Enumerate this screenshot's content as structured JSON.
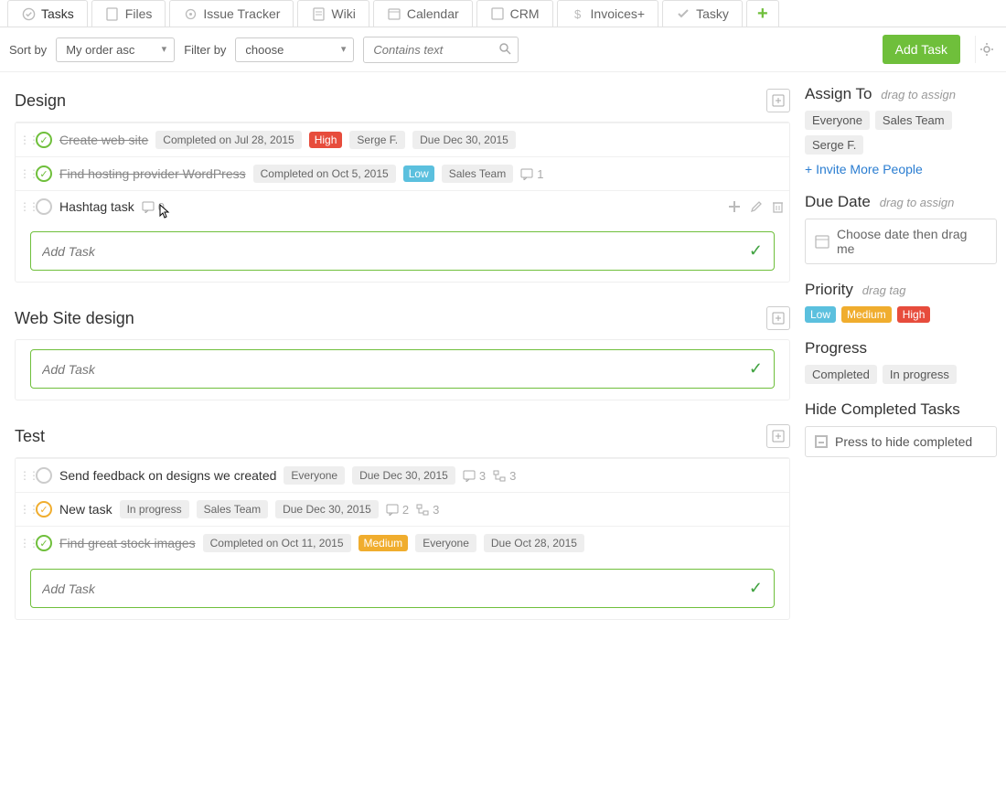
{
  "tabs": [
    "Tasks",
    "Files",
    "Issue Tracker",
    "Wiki",
    "Calendar",
    "CRM",
    "Invoices+",
    "Tasky"
  ],
  "toolbar": {
    "sort_label": "Sort by",
    "sort_value": "My order asc",
    "filter_label": "Filter by",
    "filter_value": "choose",
    "search_placeholder": "Contains text",
    "add_task_btn": "Add Task"
  },
  "groups": [
    {
      "title": "Design",
      "tasks": [
        {
          "title": "Create web site",
          "done": true,
          "check": "green",
          "chips": [
            "Completed on Jul 28, 2015"
          ],
          "priority": "High",
          "assignee": "Serge F.",
          "due": "Due Dec 30, 2015"
        },
        {
          "title": "Find hosting provider WordPress",
          "done": true,
          "check": "green",
          "chips": [
            "Completed on Oct 5, 2015"
          ],
          "priority": "Low",
          "assignee": "Sales Team",
          "comments": "1"
        },
        {
          "title": "Hashtag task",
          "done": false,
          "check": "gray",
          "comments": "0",
          "hover": true
        }
      ],
      "add_placeholder": "Add Task"
    },
    {
      "title": "Web Site design",
      "tasks": [],
      "add_placeholder": "Add Task"
    },
    {
      "title": "Test",
      "tasks": [
        {
          "title": "Send feedback on designs we created",
          "done": false,
          "check": "gray",
          "assignee": "Everyone",
          "due": "Due Dec 30, 2015",
          "comments": "3",
          "subtasks": "3"
        },
        {
          "title": "New task",
          "done": false,
          "check": "yellow",
          "chips": [
            "In progress"
          ],
          "assignee": "Sales Team",
          "due": "Due Dec 30, 2015",
          "comments": "2",
          "subtasks": "3"
        },
        {
          "title": "Find great stock images",
          "done": true,
          "check": "green",
          "chips": [
            "Completed on Oct 11, 2015"
          ],
          "priority": "Medium",
          "assignee": "Everyone",
          "due": "Due Oct 28, 2015"
        }
      ],
      "add_placeholder": "Add Task"
    }
  ],
  "sidebar": {
    "assign": {
      "title": "Assign To",
      "hint": "drag to assign",
      "tags": [
        "Everyone",
        "Sales Team",
        "Serge F."
      ],
      "invite": "+ Invite More People"
    },
    "due": {
      "title": "Due Date",
      "hint": "drag to assign",
      "box": "Choose date then drag me"
    },
    "priority": {
      "title": "Priority",
      "hint": "drag tag",
      "items": [
        "Low",
        "Medium",
        "High"
      ]
    },
    "progress": {
      "title": "Progress",
      "tags": [
        "Completed",
        "In progress"
      ]
    },
    "hide": {
      "title": "Hide Completed Tasks",
      "box": "Press to hide completed"
    }
  }
}
